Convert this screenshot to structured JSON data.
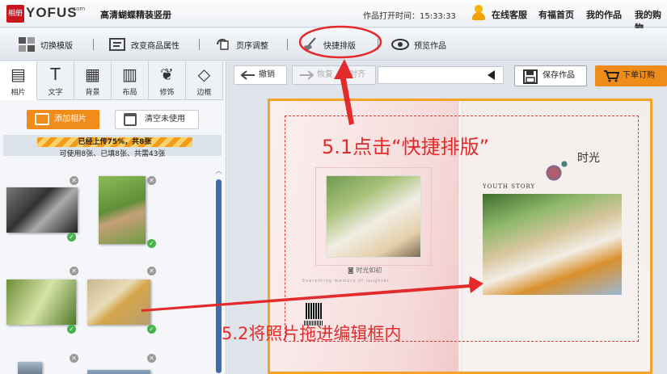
{
  "app": {
    "logo_mark": "相册",
    "logo_text": "YOFUS",
    "logo_sup": ".com",
    "product_title": "高清蝴蝶精装竖册",
    "open_time_label": "作品打开时间：",
    "open_time": "15:33:33",
    "top_links": [
      "在线客服",
      "有福首页",
      "我的作品",
      "我的购物"
    ]
  },
  "toolbar": {
    "items": [
      {
        "label": "切换模版",
        "icon": "switch-template-icon"
      },
      {
        "label": "改变商品属性",
        "icon": "product-property-icon"
      },
      {
        "label": "页序调整",
        "icon": "page-order-icon"
      },
      {
        "label": "快捷排版",
        "icon": "broom-icon"
      },
      {
        "label": "预览作品",
        "icon": "eye-icon"
      }
    ]
  },
  "sidebar": {
    "tabs": [
      {
        "label": "相片",
        "glyph": "▤",
        "icon": "film-icon"
      },
      {
        "label": "文字",
        "glyph": "T",
        "icon": "text-icon"
      },
      {
        "label": "背景",
        "glyph": "▦",
        "icon": "background-icon"
      },
      {
        "label": "布局",
        "glyph": "▥",
        "icon": "layout-icon"
      },
      {
        "label": "修饰",
        "glyph": "❦",
        "icon": "decoration-icon"
      },
      {
        "label": "边框",
        "glyph": "◇",
        "icon": "border-icon"
      }
    ],
    "add_photo_label": "添加相片",
    "clear_unused_label": "清空未使用",
    "upload_progress_text": "已经上传75%，共8张",
    "upload_progress": 0.75,
    "usable_text": "可使用8张、已填8张、共需43张"
  },
  "editor": {
    "undo_label": "撤销",
    "redo_label": "恢复",
    "align_label": "对齐",
    "save_label": "保存作品",
    "order_label": "下单订购",
    "page_caption": "时光如初",
    "page_caption_sub": "Everything memory of laughter",
    "youth_story": "YOUTH STORY",
    "title_glyph": "时光"
  },
  "annotations": {
    "step1": "5.1点击“快捷排版”",
    "step2": "5.2将照片拖进编辑框内",
    "accent": "#e42b2b"
  },
  "colors": {
    "orange": "#f08c1a",
    "frame": "#f3a32a",
    "scroll": "#3b6db0",
    "check": "#47b14a"
  }
}
